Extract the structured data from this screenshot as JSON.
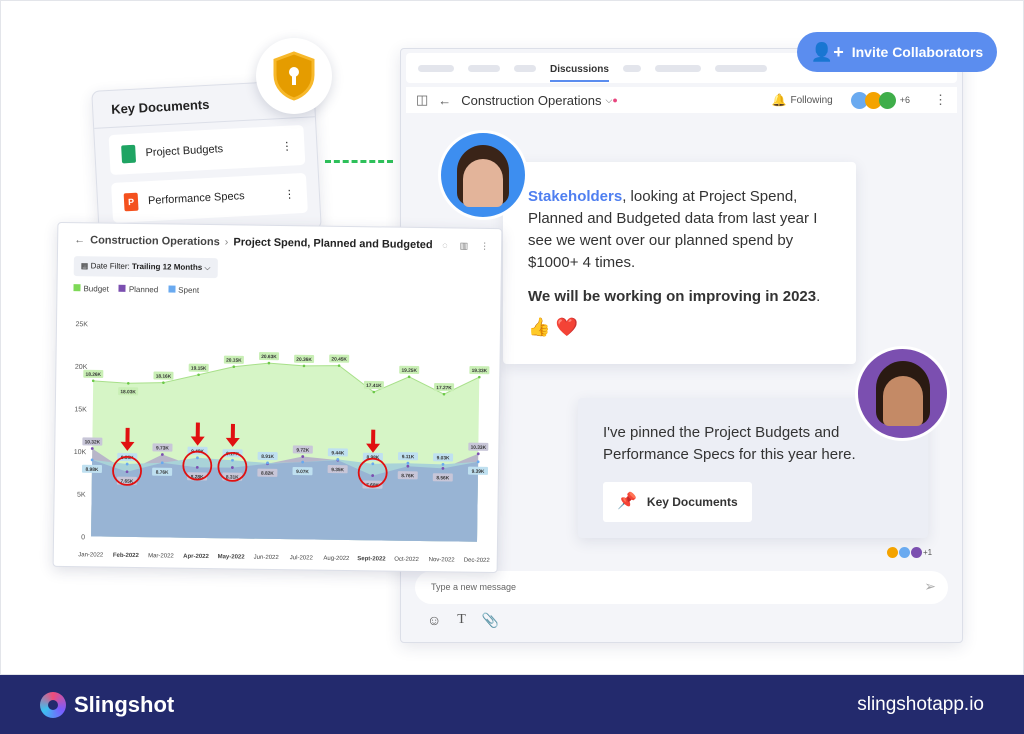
{
  "invite_button": {
    "label": "Invite Collaborators",
    "icon": "add-user-icon"
  },
  "key_documents": {
    "title": "Key Documents",
    "items": [
      {
        "label": "Project Budgets",
        "icon": "sheets-icon",
        "color": "#1fa463"
      },
      {
        "label": "Performance Specs",
        "icon": "slides-icon",
        "color": "#f4511e"
      }
    ]
  },
  "chat": {
    "tabs": {
      "active": "Discussions"
    },
    "header": {
      "title": "Construction Operations",
      "following": "Following",
      "extra_members": "+6"
    },
    "message1": {
      "mention": "Stakeholders",
      "text": ", looking at Project Spend, Planned and Budgeted data from last year I see we went over our planned spend by $1000+ 4 times.",
      "bold": "We will be working on improving in 2023",
      "bold_end": ".",
      "reactions": [
        "👍",
        "❤️"
      ]
    },
    "message2": {
      "text": "I've pinned the Project Budgets and Performance Specs for this year here.",
      "button": "Key Documents",
      "seen_extra": "+1"
    },
    "input": {
      "placeholder": "Type a new message"
    }
  },
  "chart_card": {
    "breadcrumb": "Construction Operations",
    "separator": "›",
    "title": "Project Spend, Planned and Budgeted",
    "filter_label": "Date Filter:",
    "filter_value": "Trailing 12 Months"
  },
  "chart_data": {
    "type": "area",
    "categories": [
      "Jan-2022",
      "Feb-2022",
      "Mar-2022",
      "Apr-2022",
      "May-2022",
      "Jun-2022",
      "Jul-2022",
      "Aug-2022",
      "Sept-2022",
      "Oct-2022",
      "Nov-2022",
      "Dec-2022"
    ],
    "series": [
      {
        "name": "Budget",
        "color": "#7ed957",
        "values": [
          18.26,
          18.03,
          18.16,
          19.15,
          20.15,
          20.63,
          20.36,
          20.45,
          17.41,
          19.25,
          17.27,
          19.33
        ],
        "labels": [
          "18.26K",
          "18.03K",
          "18.16K",
          "19.15K",
          "20.15K",
          "20.63K",
          "20.36K",
          "20.45K",
          "17.41K",
          "19.25K",
          "17.27K",
          "19.33K"
        ]
      },
      {
        "name": "Planned",
        "color": "#7b4fb0",
        "values": [
          10.32,
          7.65,
          9.73,
          8.28,
          8.31,
          8.82,
          9.72,
          9.35,
          7.6,
          8.76,
          8.56,
          10.33
        ],
        "labels": [
          "10.32K",
          "7.65K",
          "9.73K",
          "8.28K",
          "8.31K",
          "8.82K",
          "9.72K",
          "9.35K",
          "7.60K",
          "8.76K",
          "8.56K",
          "10.33K"
        ]
      },
      {
        "name": "Spent",
        "color": "#6aaaf0",
        "values": [
          8.98,
          8.55,
          8.76,
          9.4,
          9.17,
          8.91,
          9.07,
          9.44,
          8.98,
          9.11,
          9.03,
          9.39
        ],
        "labels": [
          "8.98K",
          "8.55K",
          "8.76K",
          "9.40K",
          "9.17K",
          "8.91K",
          "9.07K",
          "9.44K",
          "8.98K",
          "9.11K",
          "9.03K",
          "9.39K"
        ]
      }
    ],
    "y_ticks": [
      "0",
      "5K",
      "10K",
      "15K",
      "20K",
      "25K"
    ],
    "ylim": [
      0,
      25
    ],
    "highlighted": [
      "Feb-2022",
      "Apr-2022",
      "May-2022",
      "Sept-2022"
    ],
    "legend": "top-left",
    "grid": false
  },
  "footer": {
    "brand": "Slingshot",
    "url": "slingshotapp.io"
  }
}
